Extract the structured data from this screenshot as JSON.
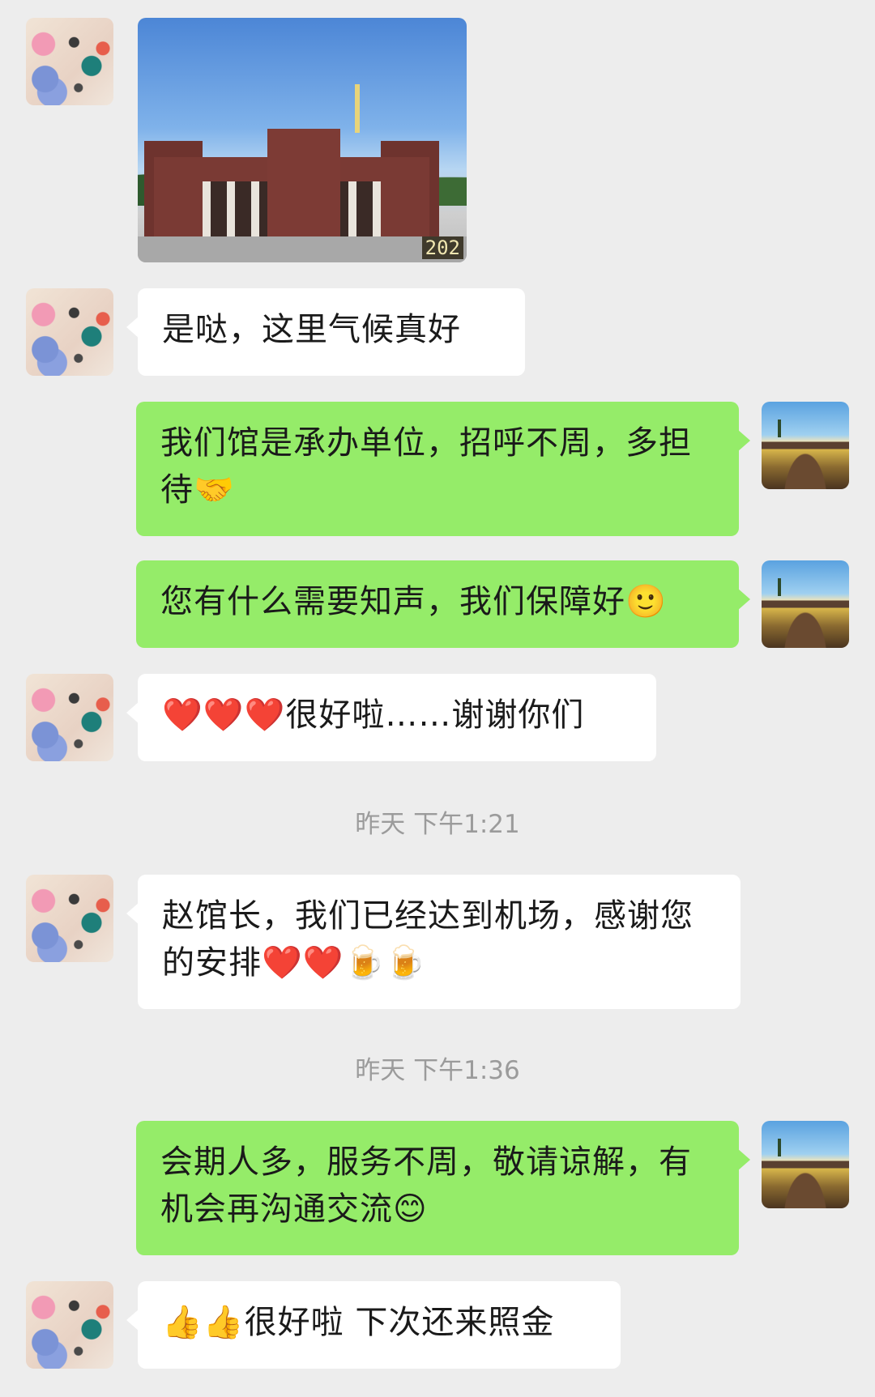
{
  "messages": [
    {
      "sender": "them",
      "type": "image",
      "stamp": "202"
    },
    {
      "sender": "them",
      "text": "是哒，这里气候真好"
    },
    {
      "sender": "me",
      "text": "我们馆是承办单位，招呼不周，多担待🤝"
    },
    {
      "sender": "me",
      "text": "您有什么需要知声，我们保障好🙂"
    },
    {
      "sender": "them",
      "text": "❤️❤️❤️很好啦……谢谢你们"
    },
    {
      "sender": "them",
      "text": "赵馆长，我们已经达到机场，感谢您的安排❤️❤️🍺🍺"
    },
    {
      "sender": "me",
      "text": "会期人多，服务不周，敬请谅解，有机会再沟通交流😊"
    },
    {
      "sender": "them",
      "text": "👍👍很好啦 下次还来照金"
    }
  ],
  "timestamps": [
    "昨天 下午1:21",
    "昨天 下午1:36"
  ],
  "colors": {
    "background": "#ededed",
    "my_bubble": "#95ec69",
    "their_bubble": "#ffffff",
    "timestamp": "#9b9b9b"
  }
}
